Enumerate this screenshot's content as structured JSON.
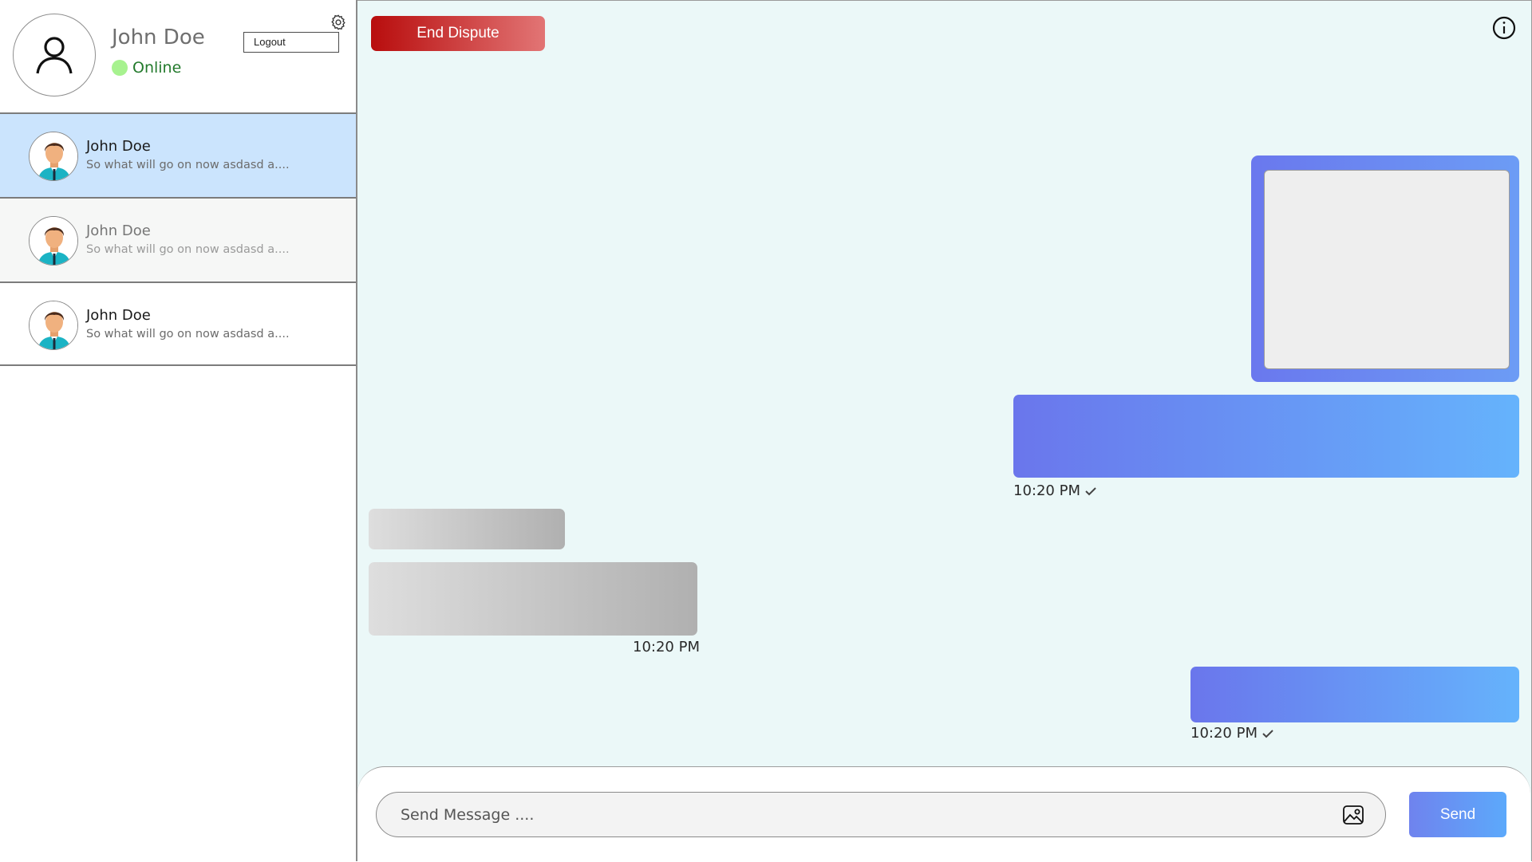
{
  "profile": {
    "name": "John Doe",
    "status": "Online",
    "logout_label": "Logout"
  },
  "conversations": [
    {
      "name": "John Doe",
      "preview": "So what will go on now asdasd a....",
      "state": "selected"
    },
    {
      "name": "John Doe",
      "preview": "So what will go on now asdasd a....",
      "state": "muted"
    },
    {
      "name": "John Doe",
      "preview": "So what will go on now asdasd a....",
      "state": "normal"
    }
  ],
  "chat": {
    "end_dispute_label": "End Dispute",
    "messages": [
      {
        "direction": "outgoing",
        "type": "image"
      },
      {
        "direction": "outgoing",
        "type": "text",
        "time": "10:20 PM",
        "delivered": true
      },
      {
        "direction": "incoming",
        "type": "text"
      },
      {
        "direction": "incoming",
        "type": "text",
        "time": "10:20 PM"
      },
      {
        "direction": "outgoing",
        "type": "text",
        "time": "10:20 PM",
        "delivered": true
      }
    ],
    "composer": {
      "placeholder": "Send Message ....",
      "send_label": "Send"
    }
  },
  "colors": {
    "accent": "#6a76ec",
    "danger": "#b80d0d",
    "online": "#a7f28f",
    "selected_row": "#cbe4fd"
  }
}
